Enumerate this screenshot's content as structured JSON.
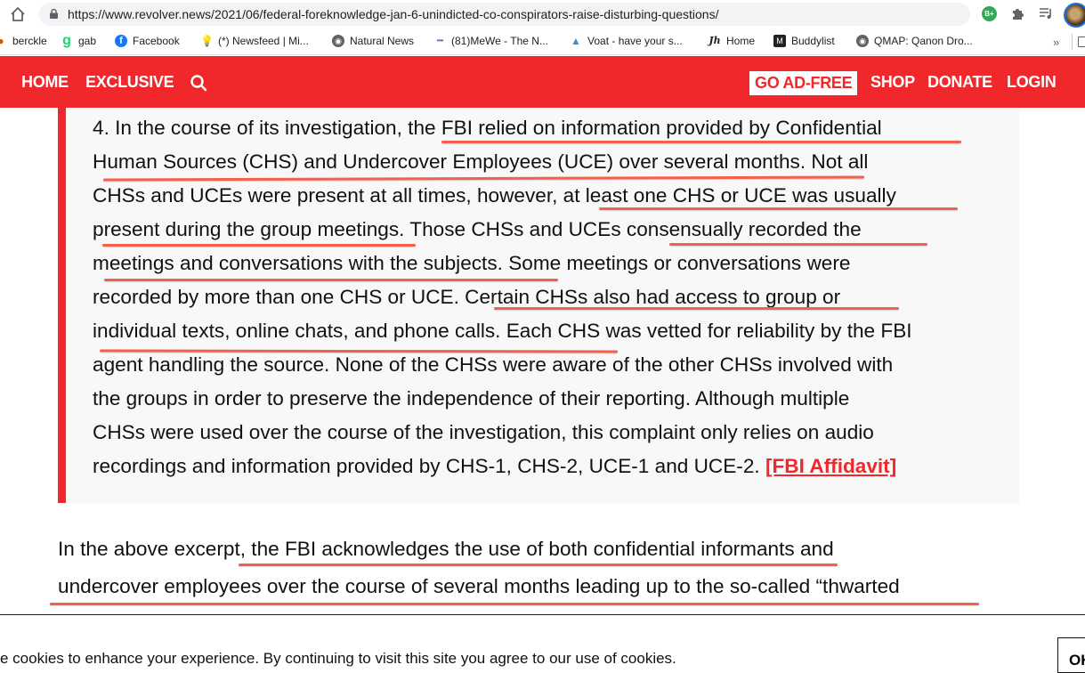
{
  "browser": {
    "url": "https://www.revolver.news/2021/06/federal-foreknowledge-jan-6-unindicted-co-conspirators-raise-disturbing-questions/",
    "extension_badge": "B+",
    "bookmarks": [
      {
        "label": "berckle",
        "icon": "berckle-icon"
      },
      {
        "label": "gab",
        "icon": "gab-icon"
      },
      {
        "label": "Facebook",
        "icon": "facebook-icon"
      },
      {
        "label": "(*) Newsfeed | Mi...",
        "icon": "lightbulb-icon"
      },
      {
        "label": "Natural News",
        "icon": "globe-icon"
      },
      {
        "label": "(81)MeWe - The N...",
        "icon": "mewe-icon"
      },
      {
        "label": "Voat - have your s...",
        "icon": "voat-icon"
      },
      {
        "label": "Home",
        "icon": "jh-icon"
      },
      {
        "label": "Buddylist",
        "icon": "buddylist-icon"
      },
      {
        "label": "QMAP: Qanon Dro...",
        "icon": "globe-icon"
      }
    ],
    "more_bookmarks": "»"
  },
  "nav": {
    "left": [
      "HOME",
      "EXCLUSIVE"
    ],
    "go_ad_free": "GO AD-FREE",
    "right": [
      "SHOP",
      "DONATE",
      "LOGIN"
    ],
    "accent_color": "#f0282c"
  },
  "quote": {
    "lines": [
      "4. In the course of its investigation, the FBI relied on information provided by Confidential",
      "Human Sources (CHS) and Undercover Employees (UCE) over several months. Not all",
      "CHSs and UCEs were present at all times, however, at least one CHS or UCE was usually",
      "present during the group meetings. Those CHSs and UCEs consensually recorded the",
      "meetings and conversations with the subjects. Some meetings or conversations were",
      "recorded by more than one CHS or UCE. Certain CHSs also had access to group or",
      "individual texts, online chats, and phone calls. Each CHS was vetted for reliability by the FBI",
      "agent handling the source. None of the CHSs were aware of the other CHSs involved with",
      "the groups in order to preserve the independence of their reporting. Although multiple",
      "CHSs were used over the course of the investigation, this complaint only relies on audio",
      "recordings and information provided by CHS-1, CHS-2, UCE-1 and UCE-2."
    ],
    "link": "[FBI Affidavit]"
  },
  "paragraph": {
    "lines": [
      "In the above excerpt, the FBI acknowledges the use of both confidential informants and",
      "undercover employees over the course of several months leading up to the so-called “thwarted"
    ]
  },
  "cookie": {
    "text": "e cookies to enhance your experience. By continuing to visit this site you agree to our use of cookies.",
    "button": "OK"
  },
  "highlight_color": "#f4604e"
}
